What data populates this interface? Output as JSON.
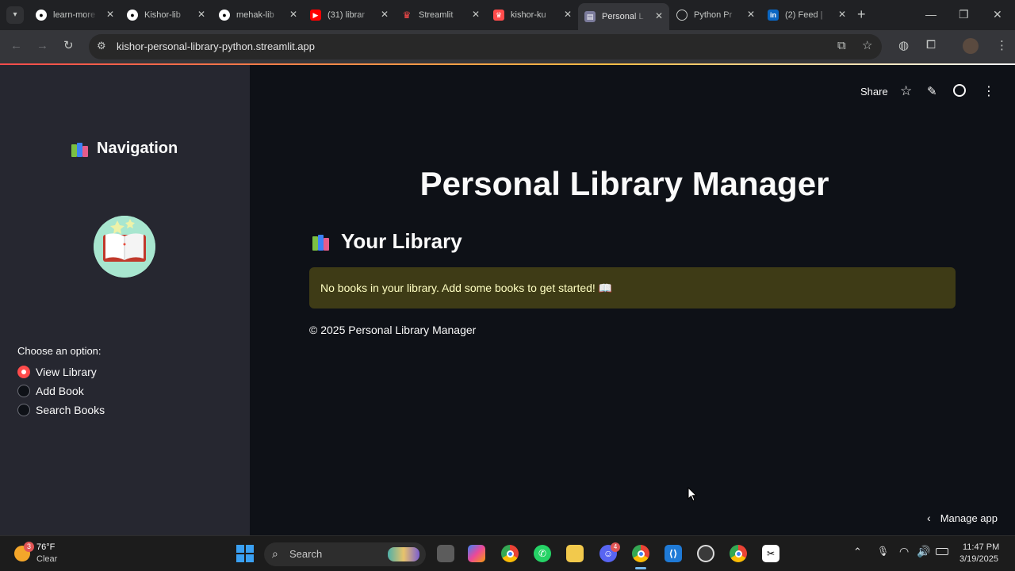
{
  "browser": {
    "tabs": [
      {
        "title": "learn-more",
        "icon": "github-icon",
        "active": false
      },
      {
        "title": "Kishor-lib",
        "icon": "github-icon",
        "active": false
      },
      {
        "title": "mehak-lib",
        "icon": "github-icon",
        "active": false
      },
      {
        "title": "(31) librar",
        "icon": "youtube-icon",
        "active": false
      },
      {
        "title": "Streamlit",
        "icon": "streamlit-icon",
        "active": false
      },
      {
        "title": "kishor-ku",
        "icon": "streamlit-icon",
        "active": false
      },
      {
        "title": "Personal L",
        "icon": "books-icon",
        "active": true
      },
      {
        "title": "Python Pr",
        "icon": "openai-icon",
        "active": false
      },
      {
        "title": "(2) Feed |",
        "icon": "linkedin-icon",
        "active": false
      }
    ],
    "url": "kishor-personal-library-python.streamlit.app"
  },
  "sidebar": {
    "title": "Navigation",
    "radio_label": "Choose an option:",
    "options": [
      {
        "label": "View Library",
        "selected": true
      },
      {
        "label": "Add Book",
        "selected": false
      },
      {
        "label": "Search Books",
        "selected": false
      }
    ]
  },
  "header": {
    "share": "Share"
  },
  "main": {
    "title": "Personal Library Manager",
    "section_title": "Your Library",
    "alert": "No books in your library. Add some books to get started! 📖",
    "footer": "© 2025 Personal Library Manager",
    "manage_app": "Manage app"
  },
  "taskbar": {
    "weather_temp": "76°F",
    "weather_desc": "Clear",
    "weather_badge": "3",
    "search": "Search",
    "time": "11:47 PM",
    "date": "3/19/2025",
    "discord_badge": "4"
  },
  "colors": {
    "accent": "#ff4b4b",
    "sidebar_bg": "#262730",
    "main_bg": "#0e1117",
    "alert_bg": "#3e3b16",
    "alert_text": "#ffffc2"
  }
}
